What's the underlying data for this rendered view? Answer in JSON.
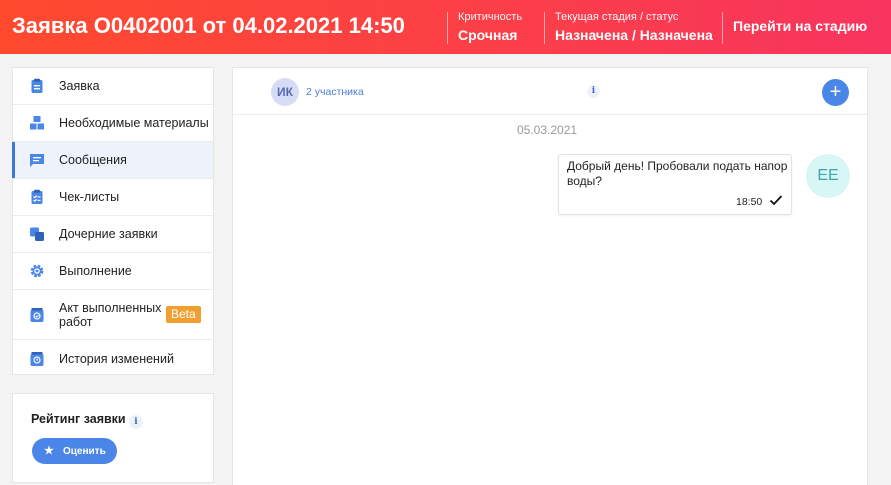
{
  "header": {
    "title": "Заявка О0402001 от 04.02.2021 14:50",
    "criticality_label": "Критичность",
    "criticality_value": "Срочная",
    "stage_label": "Текущая стадия / статус",
    "stage_value": "Назначена / Назначена",
    "goto_stage": "Перейти на стадию"
  },
  "sidebar": {
    "items": [
      {
        "label": "Заявка",
        "icon": "clipboard-icon"
      },
      {
        "label": "Необходимые материалы",
        "icon": "boxes-icon"
      },
      {
        "label": "Сообщения",
        "icon": "message-icon",
        "active": true
      },
      {
        "label": "Чек-листы",
        "icon": "checklist-icon"
      },
      {
        "label": "Дочерние заявки",
        "icon": "child-requests-icon"
      },
      {
        "label": "Выполнение",
        "icon": "gear-icon"
      },
      {
        "label": "Акт выполненных работ",
        "icon": "act-icon",
        "badge": "Beta"
      },
      {
        "label": "История изменений",
        "icon": "history-icon"
      }
    ]
  },
  "rating": {
    "title": "Рейтинг заявки",
    "info": "i",
    "button": "Оценить"
  },
  "chat": {
    "avatar_initials": "ИК",
    "participants": "2 участника",
    "info": "i",
    "add": "+",
    "date": "05.03.2021",
    "message": {
      "text": "Добрый день! Пробовали подать напор воды?",
      "time": "18:50",
      "author_initials": "ЕЕ"
    }
  },
  "colors": {
    "header_gradient_start": "#ff4a2e",
    "header_gradient_end": "#f7345f",
    "accent": "#4a86e8",
    "beta": "#f0a030"
  }
}
